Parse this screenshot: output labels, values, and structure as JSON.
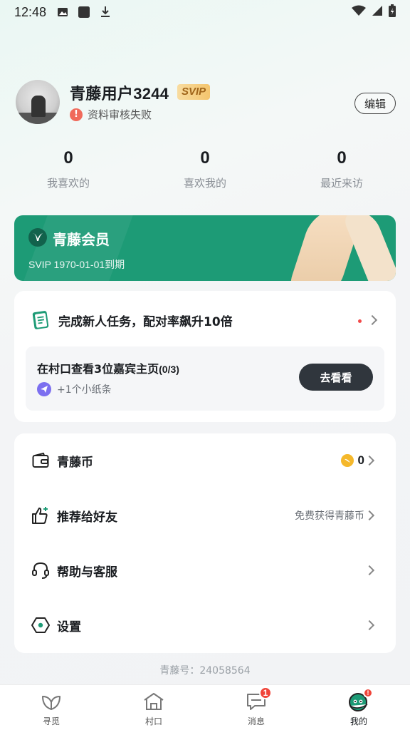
{
  "status_bar": {
    "time": "12:48",
    "icons": [
      "image-icon",
      "square-icon",
      "download-icon"
    ],
    "right_icons": [
      "wifi-icon",
      "signal-icon",
      "battery-charging-icon"
    ]
  },
  "profile": {
    "username": "青藤用户3244",
    "badge": "SVIP",
    "review_status": "资料审核失败",
    "edit_label": "编辑"
  },
  "stats": [
    {
      "value": "0",
      "label": "我喜欢的"
    },
    {
      "value": "0",
      "label": "喜欢我的"
    },
    {
      "value": "0",
      "label": "最近来访"
    }
  ],
  "membership": {
    "title": "青藤会员",
    "expire": "SVIP 1970-01-01到期",
    "brand_color": "#1d9b76"
  },
  "task": {
    "title": "完成新人任务，配对率飙升10倍",
    "item_title": "在村口查看3位嘉宾主页",
    "item_progress": "(0/3)",
    "reward": "+1个小纸条",
    "go_label": "去看看"
  },
  "menu": [
    {
      "icon": "wallet-icon",
      "label": "青藤币",
      "right": "0"
    },
    {
      "icon": "thumbs-up-icon",
      "label": "推荐给好友",
      "right": "免费获得青藤币"
    },
    {
      "icon": "headset-icon",
      "label": "帮助与客服",
      "right": ""
    },
    {
      "icon": "settings-hexagon-icon",
      "label": "设置",
      "right": ""
    }
  ],
  "vine_id": "青藤号：24058564",
  "tabs": [
    {
      "label": "寻觅",
      "icon": "leaf-icon",
      "active": false
    },
    {
      "label": "村口",
      "icon": "house-icon",
      "active": false
    },
    {
      "label": "消息",
      "icon": "chat-icon",
      "badge": "1",
      "active": false
    },
    {
      "label": "我的",
      "icon": "profile-face-icon",
      "badge": "!",
      "active": true
    }
  ]
}
